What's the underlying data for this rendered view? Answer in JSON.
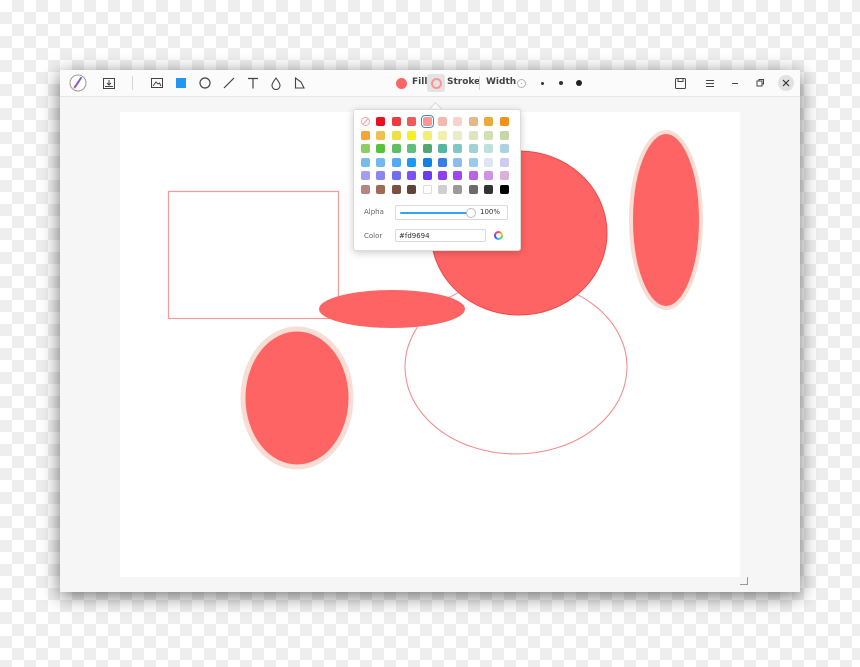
{
  "toolbar": {
    "icons": [
      "brush-logo-icon",
      "import-icon",
      "image-icon",
      "rectangle-icon",
      "ellipse-icon",
      "line-icon",
      "text-icon",
      "blur-icon",
      "crop-icon"
    ],
    "fill_label": "Fill",
    "stroke_label": "Stroke",
    "width_label": "Width",
    "fill_color": "#ff6464",
    "stroke_color": "#fd9694",
    "window_buttons": [
      "save-icon",
      "menu-icon",
      "minimize-icon",
      "restore-icon",
      "close-icon"
    ]
  },
  "color_picker": {
    "swatches": [
      "none",
      "#e8101a",
      "#ee3b3b",
      "#f25a5a",
      "#fd9694",
      "#f5b8b0",
      "#f7d3cc",
      "#e6b888",
      "#ecaa3c",
      "#f0921a",
      "#f3a633",
      "#eec04f",
      "#eede48",
      "#f6f020",
      "#f3ef70",
      "#f2f0b0",
      "#e9ebc9",
      "#dde5be",
      "#d2dfae",
      "#c7d6a6",
      "#8ece60",
      "#58c33a",
      "#5fbf64",
      "#62be80",
      "#4ea871",
      "#54b5a0",
      "#7ec8c8",
      "#9fd3d1",
      "#bfe0dd",
      "#a9d3de",
      "#79bde7",
      "#74b8f0",
      "#55a8f2",
      "#1b9af1",
      "#1184e0",
      "#3a7ee3",
      "#8cbbf0",
      "#9cc9ee",
      "#dfe5f5",
      "#cfc9f2",
      "#a39ef2",
      "#8b85f0",
      "#6f6ff0",
      "#7d52f0",
      "#6a3cf2",
      "#8e3ff0",
      "#a045f0",
      "#bb62e8",
      "#cf93e3",
      "#ddb0d5",
      "#b88380",
      "#a06a55",
      "#7d5043",
      "#5f4238",
      "#ffffff",
      "#cfcfcf",
      "#9a9a9a",
      "#6b6b6b",
      "#333333",
      "#000000"
    ],
    "selected_color": "#fd9694",
    "alpha_label": "Alpha",
    "alpha_value": "100%",
    "color_label": "Color",
    "color_value": "#fd9694"
  }
}
